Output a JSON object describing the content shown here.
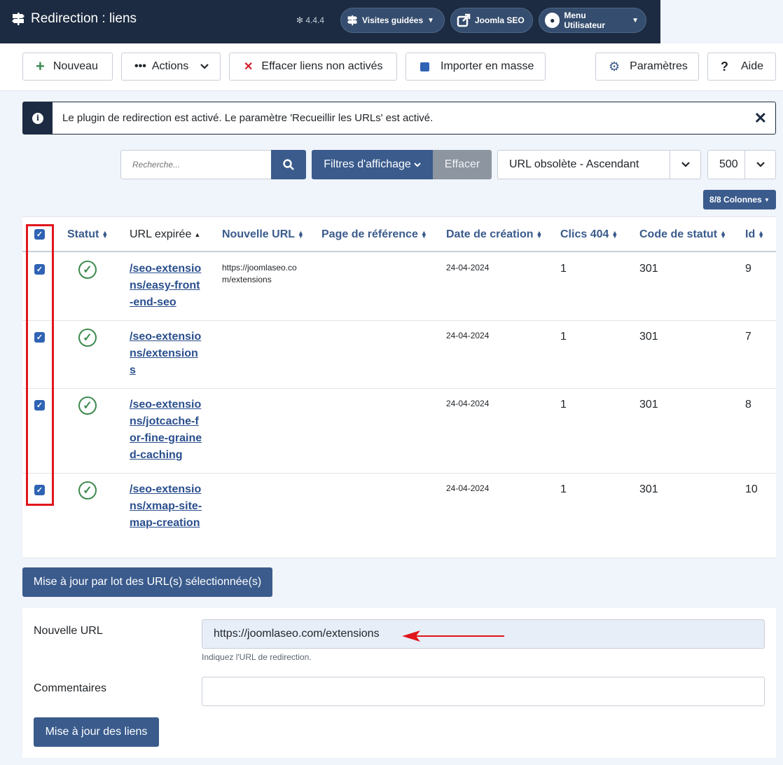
{
  "header": {
    "title": "Redirection : liens",
    "version": "4.4.4",
    "guided_tours": "Visites guidées",
    "joomla_seo": "Joomla SEO",
    "user_menu": "Menu Utilisateur"
  },
  "toolbar": {
    "new": "Nouveau",
    "actions": "Actions",
    "purge": "Effacer liens non activés",
    "import": "Importer en masse",
    "options": "Paramètres",
    "help": "Aide"
  },
  "alert": {
    "message": "Le plugin de redirection est activé. Le paramètre 'Recueillir les URLs' est activé."
  },
  "filters": {
    "search_placeholder": "Recherche...",
    "filter_options": "Filtres d'affichage",
    "clear": "Effacer",
    "sort": "URL obsolète - Ascendant",
    "limit": "500",
    "columns": "8/8 Colonnes"
  },
  "table": {
    "headers": {
      "status": "Statut",
      "old_url": "URL expirée",
      "new_url": "Nouvelle URL",
      "referer": "Page de référence",
      "created": "Date de création",
      "hits": "Clics 404",
      "code": "Code de statut",
      "id": "Id"
    },
    "rows": [
      {
        "old_url": "/seo-extensions/easy-front-end-seo",
        "new_url": "https://joomlaseo.com/extensions",
        "created": "24-04-2024",
        "hits": "1",
        "code": "301",
        "id": "9"
      },
      {
        "old_url": "/seo-extensions/extensions",
        "new_url": "",
        "created": "24-04-2024",
        "hits": "1",
        "code": "301",
        "id": "7"
      },
      {
        "old_url": "/seo-extensions/jotcache-for-fine-grained-caching",
        "new_url": "",
        "created": "24-04-2024",
        "hits": "1",
        "code": "301",
        "id": "8"
      },
      {
        "old_url": "/seo-extensions/xmap-site-map-creation",
        "new_url": "",
        "created": "24-04-2024",
        "hits": "1",
        "code": "301",
        "id": "10"
      }
    ]
  },
  "batch": {
    "button": "Mise à jour par lot des URL(s) sélectionnée(s)",
    "new_url_label": "Nouvelle URL",
    "new_url_value": "https://joomlaseo.com/extensions",
    "new_url_hint": "Indiquez l'URL de redirection.",
    "comment_label": "Commentaires",
    "comment_value": "",
    "update_button": "Mise à jour des liens"
  },
  "colors": {
    "header_bg": "#1c2b41",
    "primary": "#3a5b8c",
    "highlight": "#e0161c",
    "success": "#3d8a4f"
  }
}
